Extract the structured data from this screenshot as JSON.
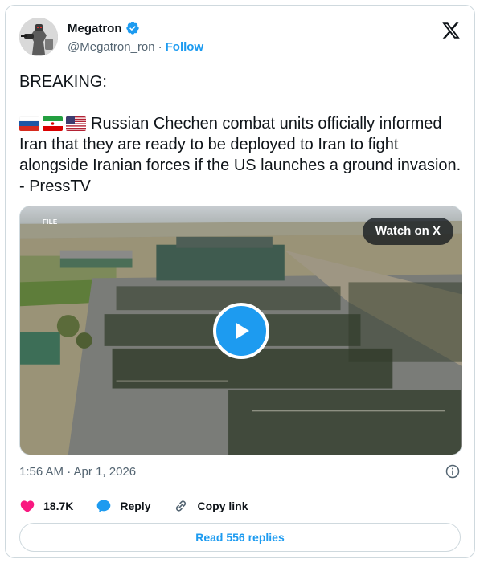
{
  "author": {
    "display_name": "Megatron",
    "handle": "@Megatron_ron",
    "follow_label": "Follow",
    "verified": true,
    "avatar_icon": "robot-avatar"
  },
  "tweet": {
    "heading": "BREAKING:",
    "flags": [
      "russia-flag",
      "iran-flag",
      "usa-flag"
    ],
    "body": "Russian Chechen combat units officially informed Iran that they are ready to be deployed to Iran to fight alongside Iranian forces if the US launches a ground invasion. - PressTV"
  },
  "media": {
    "type": "video",
    "file_tag": "FILE",
    "watch_label": "Watch on X",
    "play_icon": "play-icon"
  },
  "meta": {
    "timestamp": "1:56 AM · Apr 1, 2026",
    "info_icon": "info-icon"
  },
  "actions": {
    "likes": "18.7K",
    "reply_label": "Reply",
    "copy_link_label": "Copy link"
  },
  "read_replies_label": "Read 556 replies",
  "colors": {
    "accent": "#1d9bf0",
    "like": "#f91880",
    "text": "#0f1419",
    "muted": "#536471",
    "border": "#cfd9de"
  }
}
